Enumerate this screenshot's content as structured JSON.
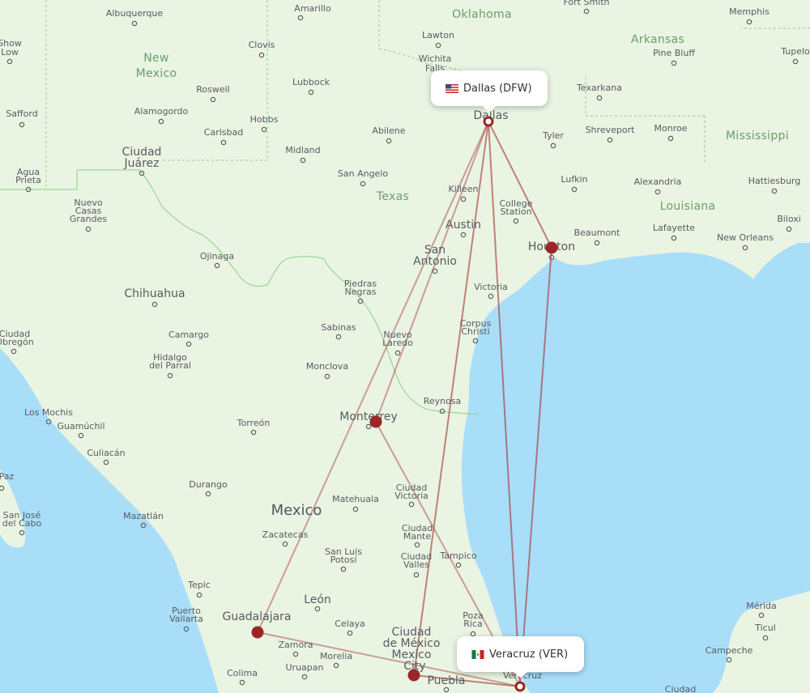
{
  "map": {
    "colors": {
      "water": "#a9def9",
      "land": "#eaf4e2",
      "route": "#a23436",
      "marker": "#9a2628",
      "region_label": "#6a9e6b",
      "city_label": "#555c62"
    },
    "origin": {
      "name": "Dallas (DFW)",
      "country_flag": "us-flag-icon"
    },
    "destination": {
      "name": "Veracruz (VER)",
      "country_flag": "mexico-flag-icon"
    },
    "stopovers": [
      "Houston",
      "Monterrey",
      "Guadalajara",
      "Mexico City"
    ],
    "regions": [
      {
        "id": "oklahoma",
        "label": "Oklahoma"
      },
      {
        "id": "arkansas",
        "label": "Arkansas"
      },
      {
        "id": "new-mexico-1",
        "label": "New"
      },
      {
        "id": "new-mexico-2",
        "label": "Mexico"
      },
      {
        "id": "mississippi",
        "label": "Mississippi"
      },
      {
        "id": "texas",
        "label": "Texas"
      },
      {
        "id": "louisiana",
        "label": "Louisiana"
      }
    ],
    "cities": [
      "Albuquerque",
      "Amarillo",
      "Fort Smith",
      "Memphis",
      "Show",
      "Low",
      "Clovis",
      "Lawton",
      "Wichita",
      "Falls",
      "Pine Bluff",
      "Tupelo",
      "Roswell",
      "Lubbock",
      "Texarkana",
      "Safford",
      "Alamogordo",
      "Hobbs",
      "Dallas",
      "Tyler",
      "Shreveport",
      "Monroe",
      "Carlsbad",
      "Abilene",
      "Ciudad",
      "Juárez",
      "Midland",
      "San Angelo",
      "Agua",
      "Prieta",
      "Lufkin",
      "Alexandria",
      "Hattiesburg",
      "Killeen",
      "College",
      "Station",
      "Nuevo",
      "Casas",
      "Grandes",
      "Austin",
      "Beaumont",
      "Lafayette",
      "Biloxi",
      "New Orleans",
      "Houston",
      "Ojinaga",
      "San",
      "Antonio",
      "Chihuahua",
      "Piedras",
      "Negras",
      "Victoria",
      "Corpus",
      "Christi",
      "Ciudad",
      "Obregón",
      "Camargo",
      "Sabinas",
      "Nuevo",
      "Laredo",
      "Hidalgo",
      "del Parral",
      "Monclova",
      "Reynosa",
      "Los Mochis",
      "Guamúchil",
      "Torreón",
      "Monterrey",
      "Culiacán",
      "Durango",
      "Paz",
      "Matehuala",
      "Ciudad",
      "Victoria",
      "Mexico",
      "San José",
      "del Cabo",
      "Mazatlán",
      "Ciudad",
      "Mante",
      "Zacatecas",
      "San Luis",
      "Potosí",
      "Tampico",
      "Ciudad",
      "Valles",
      "Tepic",
      "León",
      "Puerto",
      "Vallarta",
      "Guadalajara",
      "Celaya",
      "Poza",
      "Rica",
      "Mérida",
      "Ticul",
      "Zamora",
      "Ciudad",
      "de México",
      "Mexico",
      "City",
      "Morelia",
      "Campeche",
      "Uruapan",
      "Colima",
      "Puebla",
      "Veracruz",
      "Ciudad"
    ]
  }
}
